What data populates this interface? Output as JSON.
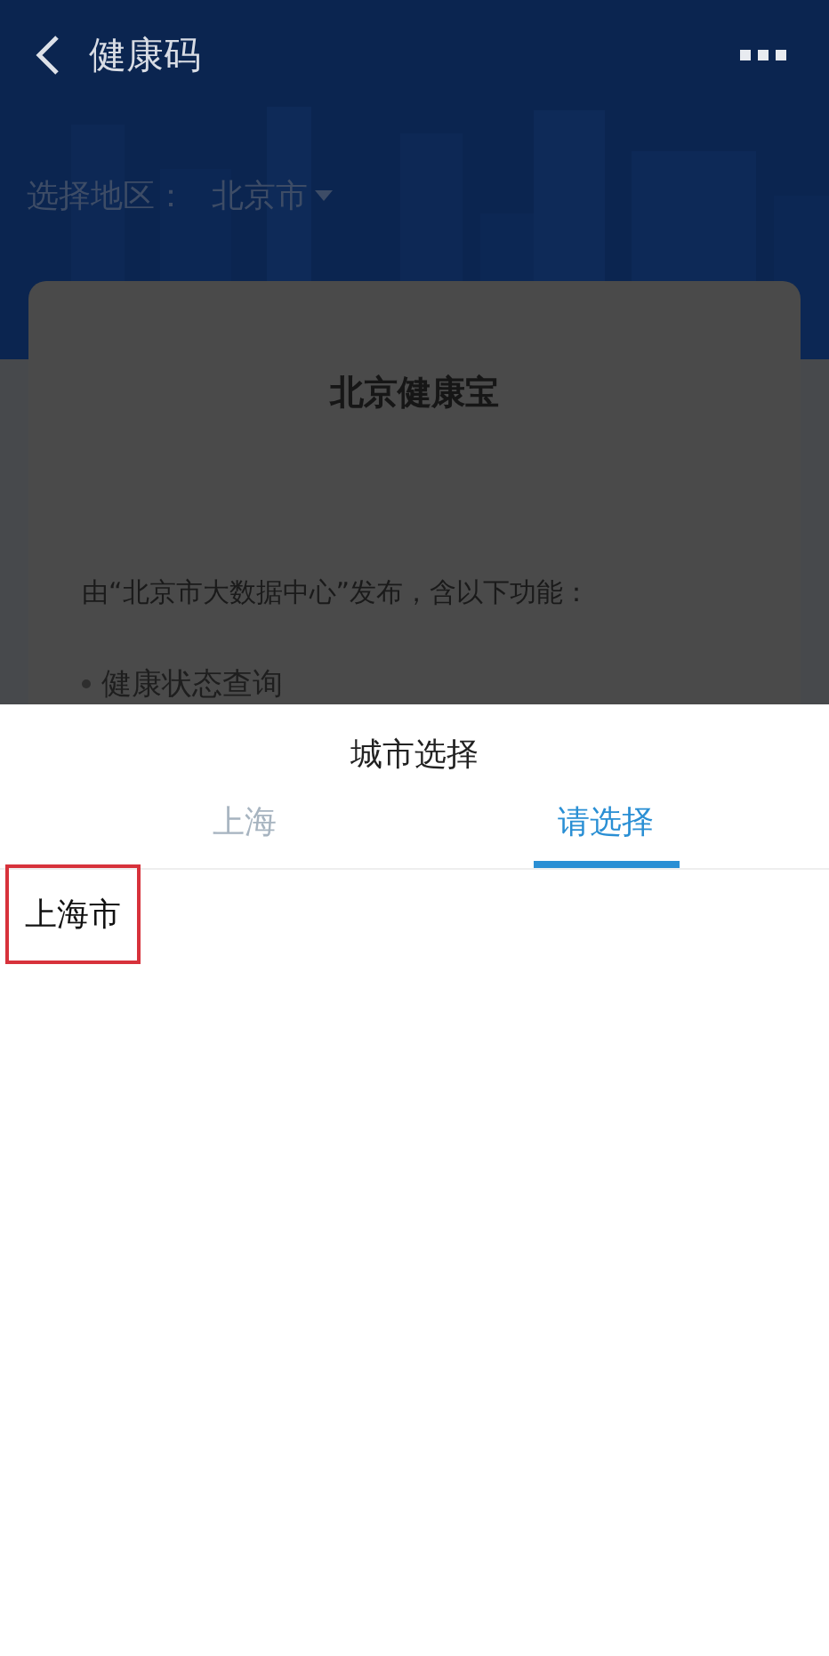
{
  "nav_bar": {
    "title": "健康码"
  },
  "region": {
    "label": "选择地区：",
    "value": "北京市"
  },
  "card": {
    "title": "北京健康宝",
    "description": "由“北京市大数据中心”发布，含以下功能：",
    "features": [
      "健康状态查询"
    ]
  },
  "city_sheet": {
    "title": "城市选择",
    "tabs": [
      {
        "label": "上海",
        "selected": false
      },
      {
        "label": "请选择",
        "selected": true
      }
    ],
    "options": [
      {
        "label": "上海市",
        "highlighted": true
      }
    ]
  }
}
